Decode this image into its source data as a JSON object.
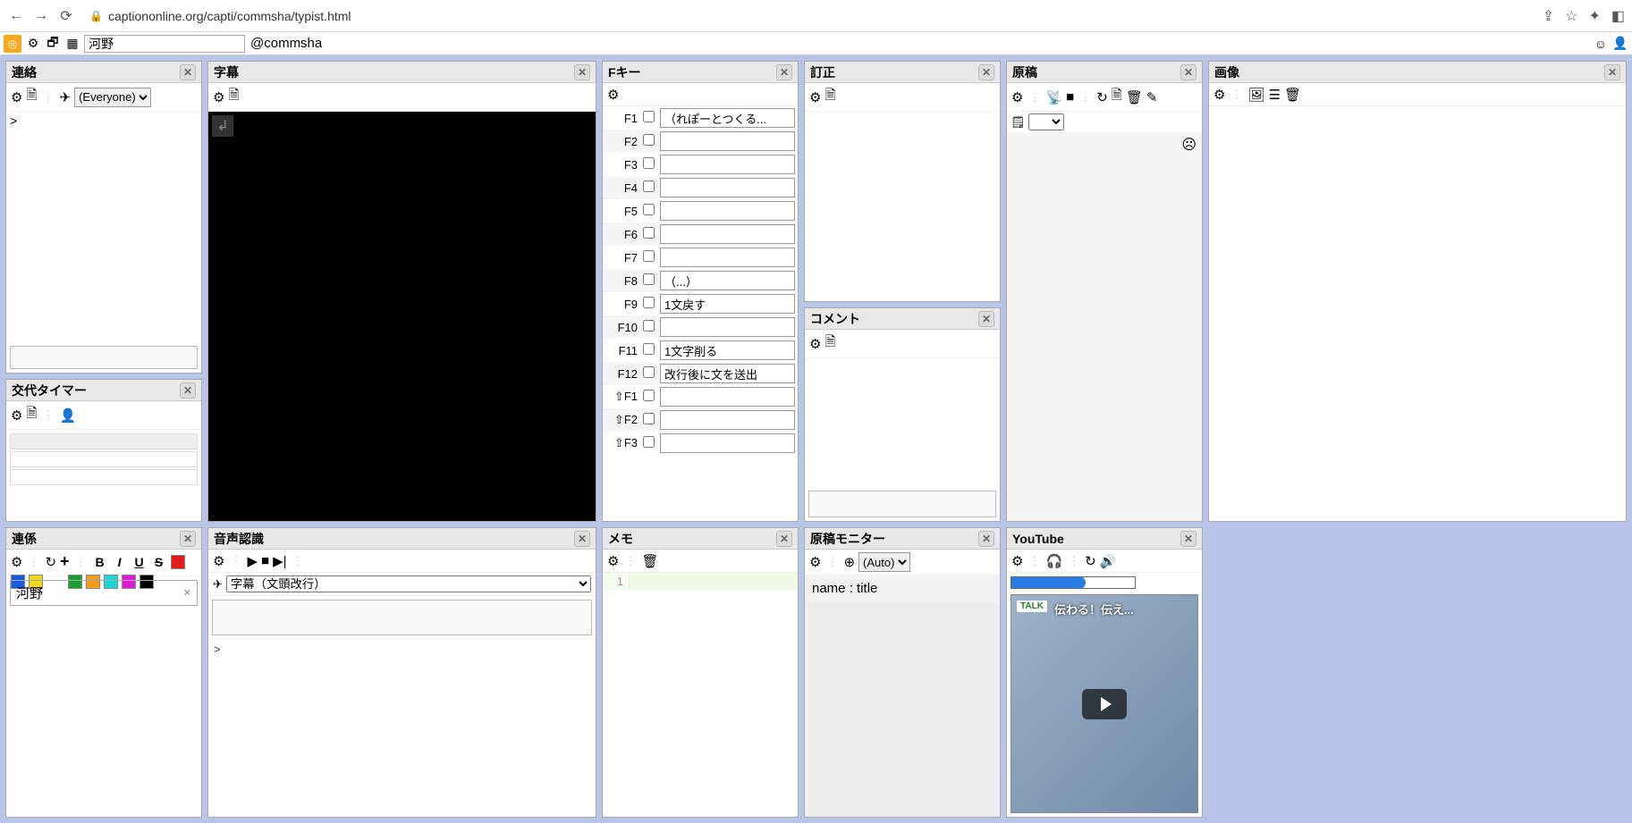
{
  "browser": {
    "url": "captiononline.org/capti/commsha/typist.html"
  },
  "app_toolbar": {
    "name_value": "河野",
    "user_handle": "@commsha"
  },
  "panels": {
    "renraku": {
      "title": "連絡",
      "select_value": "(Everyone)",
      "output": ">"
    },
    "timer": {
      "title": "交代タイマー"
    },
    "jimaku": {
      "title": "字幕"
    },
    "fkey": {
      "title": "Fキー",
      "rows": [
        {
          "label": "F1",
          "value": "（れぽーとつくる..."
        },
        {
          "label": "F2",
          "value": ""
        },
        {
          "label": "F3",
          "value": ""
        },
        {
          "label": "F4",
          "value": ""
        },
        {
          "label": "F5",
          "value": ""
        },
        {
          "label": "F6",
          "value": ""
        },
        {
          "label": "F7",
          "value": ""
        },
        {
          "label": "F8",
          "value": "（...）"
        },
        {
          "label": "F9",
          "value": "1文戻す"
        },
        {
          "label": "F10",
          "value": ""
        },
        {
          "label": "F11",
          "value": "1文字削る"
        },
        {
          "label": "F12",
          "value": "改行後に文を送出"
        },
        {
          "label": "⇧F1",
          "value": ""
        },
        {
          "label": "⇧F2",
          "value": ""
        },
        {
          "label": "⇧F3",
          "value": ""
        }
      ]
    },
    "teisei": {
      "title": "訂正"
    },
    "comment": {
      "title": "コメント"
    },
    "genkou": {
      "title": "原稿"
    },
    "gazou": {
      "title": "画像"
    },
    "renkei": {
      "title": "連係",
      "input_value": "河野",
      "colors": [
        "#e21b1b",
        "#1b5be2",
        "#f7d51b",
        "#ffffff_gap",
        "#1b9e2f",
        "#f79d1b",
        "#1bd6d6",
        "#e21bd6",
        "#000000"
      ]
    },
    "voice": {
      "title": "音声認識",
      "select_value": "字幕（文頭改行）",
      "output": ">"
    },
    "memo": {
      "title": "メモ",
      "line_no": "1"
    },
    "gmon": {
      "title": "原稿モニター",
      "select_value": "(Auto)",
      "row_text": "name : title"
    },
    "youtube": {
      "title": "YouTube",
      "badge": "TALK",
      "video_title": "伝わる！伝え..."
    }
  }
}
